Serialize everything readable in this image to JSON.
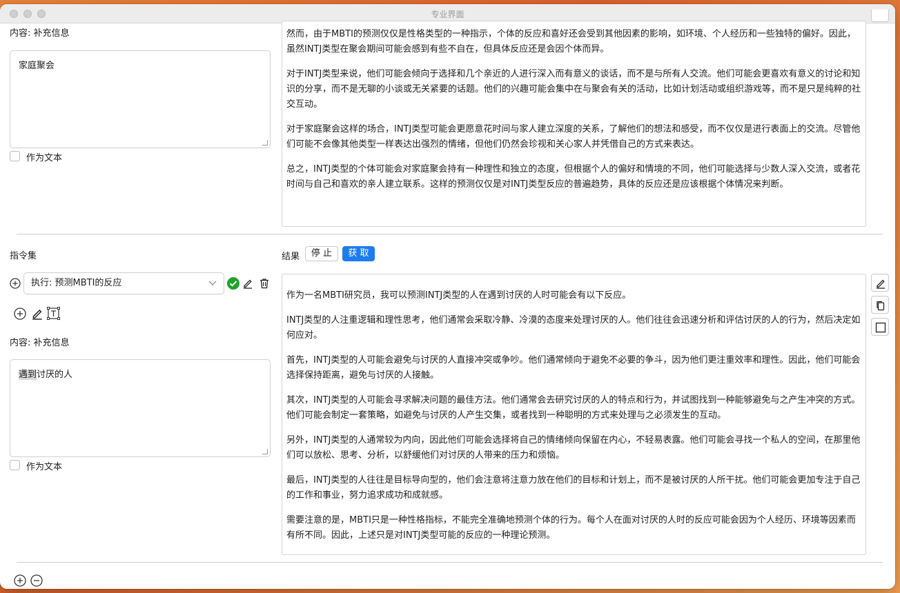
{
  "window": {
    "title": "专业界面"
  },
  "top_section": {
    "content_label": "内容: 补充信息",
    "input_value": "家庭聚会",
    "as_text_label": "作为文本",
    "output_paragraphs": [
      "然而，由于MBTI的预测仅仅是性格类型的一种指示，个体的反应和喜好还会受到其他因素的影响，如环境、个人经历和一些独特的偏好。因此，虽然INTJ类型在聚会期间可能会感到有些不自在，但具体反应还是会因个体而异。",
      "对于INTJ类型来说，他们可能会倾向于选择和几个亲近的人进行深入而有意义的谈话，而不是与所有人交流。他们可能会更喜欢有意义的讨论和知识的分享，而不是无聊的小谈或无关紧要的话题。他们的兴趣可能会集中在与聚会有关的活动，比如计划活动或组织游戏等，而不是只是纯粹的社交互动。",
      "对于家庭聚会这样的场合，INTJ类型可能会更愿意花时间与家人建立深度的关系，了解他们的想法和感受，而不仅仅是进行表面上的交流。尽管他们可能不会像其他类型一样表达出强烈的情绪，但他们仍然会珍视和关心家人并凭借自己的方式来表达。",
      "总之，INTJ类型的个体可能会对家庭聚会持有一种理性和独立的态度，但根据个人的偏好和情境的不同，他们可能选择与少数人深入交流，或者花时间与自己和喜欢的亲人建立联系。这样的预测仅仅是对INTJ类型反应的普遍趋势，具体的反应还是应该根据个体情况来判断。"
    ]
  },
  "bottom_section": {
    "instruction_set_label": "指令集",
    "result_label": "结果",
    "stop_label": "停 止",
    "fetch_label": "获 取",
    "select_value": "执行: 预测MBTI的反应",
    "content_label": "内容: 补充信息",
    "input_value_highlight": "遇到",
    "input_value_rest": "讨厌的人",
    "as_text_label": "作为文本",
    "output_paragraphs": [
      "作为一名MBTI研究员，我可以预测INTJ类型的人在遇到讨厌的人时可能会有以下反应。",
      "INTJ类型的人注重逻辑和理性思考，他们通常会采取冷静、冷漠的态度来处理讨厌的人。他们往往会迅速分析和评估讨厌的人的行为，然后决定如何应对。",
      "首先，INTJ类型的人可能会避免与讨厌的人直接冲突或争吵。他们通常倾向于避免不必要的争斗，因为他们更注重效率和理性。因此，他们可能会选择保持距离，避免与讨厌的人接触。",
      "其次，INTJ类型的人可能会寻求解决问题的最佳方法。他们通常会去研究讨厌的人的特点和行为，并试图找到一种能够避免与之产生冲突的方式。他们可能会制定一套策略，如避免与讨厌的人产生交集，或者找到一种聪明的方式来处理与之必须发生的互动。",
      "另外，INTJ类型的人通常较为内向，因此他们可能会选择将自己的情绪倾向保留在内心，不轻易表露。他们可能会寻找一个私人的空间，在那里他们可以放松、思考、分析，以舒缓他们对讨厌的人带来的压力和烦恼。",
      "最后，INTJ类型的人往往是目标导向型的，他们会注意将注意力放在他们的目标和计划上，而不是被讨厌的人所干扰。他们可能会更加专注于自己的工作和事业，努力追求成功和成就感。",
      "需要注意的是，MBTI只是一种性格指标，不能完全准确地预测个体的行为。每个人在面对讨厌的人时的反应可能会因为个人经历、环境等因素而有所不同。因此，上述只是对INTJ类型可能的反应的一种理论预测。"
    ]
  },
  "colors": {
    "accent": "#1c7cf0",
    "success": "#1fa32a"
  },
  "icons": [
    "plus-circle-icon",
    "check-circle-icon",
    "pencil-icon",
    "trash-icon",
    "text-box-icon",
    "copy-icon",
    "square-icon",
    "minus-circle-icon",
    "chevron-down-icon"
  ]
}
